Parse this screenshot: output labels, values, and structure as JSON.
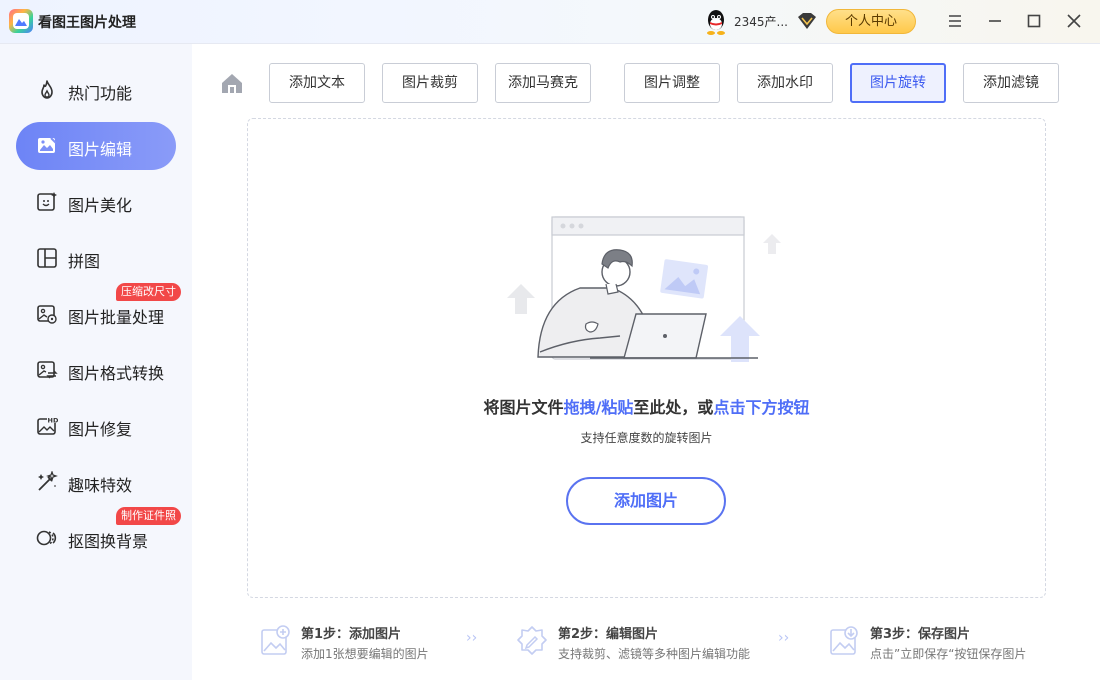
{
  "app": {
    "title": "看图王图片处理"
  },
  "header": {
    "account_name": "2345产...",
    "user_center": "个人中心"
  },
  "sidebar": {
    "items": [
      {
        "label": "热门功能",
        "icon": "fire-icon"
      },
      {
        "label": "图片编辑",
        "icon": "image-edit-icon",
        "active": true
      },
      {
        "label": "图片美化",
        "icon": "image-sparkle-icon"
      },
      {
        "label": "拼图",
        "icon": "collage-icon"
      },
      {
        "label": "图片批量处理",
        "icon": "image-batch-icon",
        "badge": "压缩改尺寸"
      },
      {
        "label": "图片格式转换",
        "icon": "image-convert-icon"
      },
      {
        "label": "图片修复",
        "icon": "hd-image-icon"
      },
      {
        "label": "趣味特效",
        "icon": "magic-wand-icon"
      },
      {
        "label": "抠图换背景",
        "icon": "cutout-icon",
        "badge": "制作证件照"
      }
    ]
  },
  "toolbar": {
    "tabs": [
      {
        "label": "添加文本"
      },
      {
        "label": "图片裁剪"
      },
      {
        "label": "添加马赛克"
      },
      {
        "label": "图片调整"
      },
      {
        "label": "添加水印"
      },
      {
        "label": "图片旋转",
        "active": true
      },
      {
        "label": "添加滤镜"
      }
    ]
  },
  "dropzone": {
    "hint_1": "将图片文件",
    "hint_hl1": "拖拽/粘贴",
    "hint_2": "至此处，或",
    "hint_hl2": "点击下方按钮",
    "sub": "支持任意度数的旋转图片",
    "add_button": "添加图片"
  },
  "steps": [
    {
      "title": "第1步：添加图片",
      "desc": "添加1张想要编辑的图片"
    },
    {
      "title": "第2步：编辑图片",
      "desc": "支持裁剪、滤镜等多种图片编辑功能"
    },
    {
      "title": "第3步：保存图片",
      "desc": "点击”立即保存“按钮保存图片"
    }
  ],
  "colors": {
    "accent": "#4f6ef7",
    "badge": "#f24848",
    "sidebar_bg": "#f5f7fd"
  }
}
